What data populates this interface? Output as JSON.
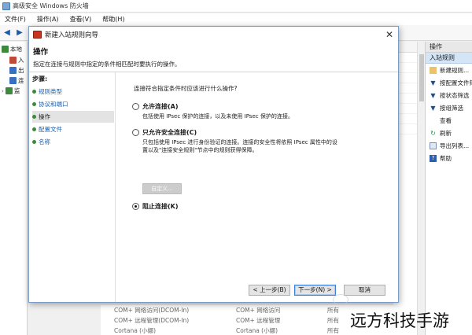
{
  "main_window": {
    "title": "高级安全 Windows 防火墙",
    "menu": [
      "文件(F)",
      "操作(A)",
      "查看(V)",
      "帮助(H)"
    ],
    "tree": [
      {
        "label": "本地",
        "icon": "firewall-icon"
      },
      {
        "label": "入",
        "icon": "inbound-rules-icon"
      },
      {
        "label": "出",
        "icon": "outbound-rules-icon"
      },
      {
        "label": "连",
        "icon": "connection-rules-icon"
      },
      {
        "label": "监",
        "icon": "monitor-icon"
      }
    ],
    "background_rows": [
      {
        "name": "COM+ 网络访问(DCOM-In)",
        "group": "COM+ 网络访问",
        "profile": "所有"
      },
      {
        "name": "COM+ 远程管理(DCOM-In)",
        "group": "COM+ 远程管理",
        "profile": "所有"
      },
      {
        "name": "Cortana (小娜)",
        "group": "Cortana (小娜)",
        "profile": "所有"
      }
    ]
  },
  "actions_pane": {
    "header": "操作",
    "section": "入站规则",
    "items": [
      {
        "label": "新建规则...",
        "icon": "new-rule-icon"
      },
      {
        "label": "按配置文件筛选",
        "icon": "filter-icon"
      },
      {
        "label": "按状态筛选",
        "icon": "filter-icon"
      },
      {
        "label": "按组筛选",
        "icon": "filter-icon"
      },
      {
        "label": "查看",
        "icon": "view-icon"
      },
      {
        "label": "刷新",
        "icon": "refresh-icon"
      },
      {
        "label": "导出列表...",
        "icon": "export-icon"
      },
      {
        "label": "帮助",
        "icon": "help-icon"
      }
    ]
  },
  "wizard": {
    "title": "新建入站规则向导",
    "header_title": "操作",
    "header_desc": "指定在连接与规则中指定的条件相匹配时要执行的操作。",
    "steps_title": "步骤:",
    "steps": [
      "规则类型",
      "协议和端口",
      "操作",
      "配置文件",
      "名称"
    ],
    "active_step": 2,
    "question": "连接符合指定条件时应该进行什么操作?",
    "options": [
      {
        "label": "允许连接(A)",
        "desc": [
          "包括使用 IPsec 保护的连接，以及未使用 IPsec 保护的连接。"
        ],
        "checked": false
      },
      {
        "label": "只允许安全连接(C)",
        "desc": [
          "只包括使用 IPsec 进行身份验证的连接。连接的安全性将依照 IPsec 属性中的设",
          "置以及\"连接安全规则\"节点中的规则获得保障。"
        ],
        "checked": false
      },
      {
        "label": "阻止连接(K)",
        "desc": [],
        "checked": true
      }
    ],
    "customize_button": "自定义...",
    "buttons": {
      "back": "< 上一步(B)",
      "next": "下一步(N) >",
      "cancel": "取消"
    }
  },
  "watermark": "远方科技手游"
}
